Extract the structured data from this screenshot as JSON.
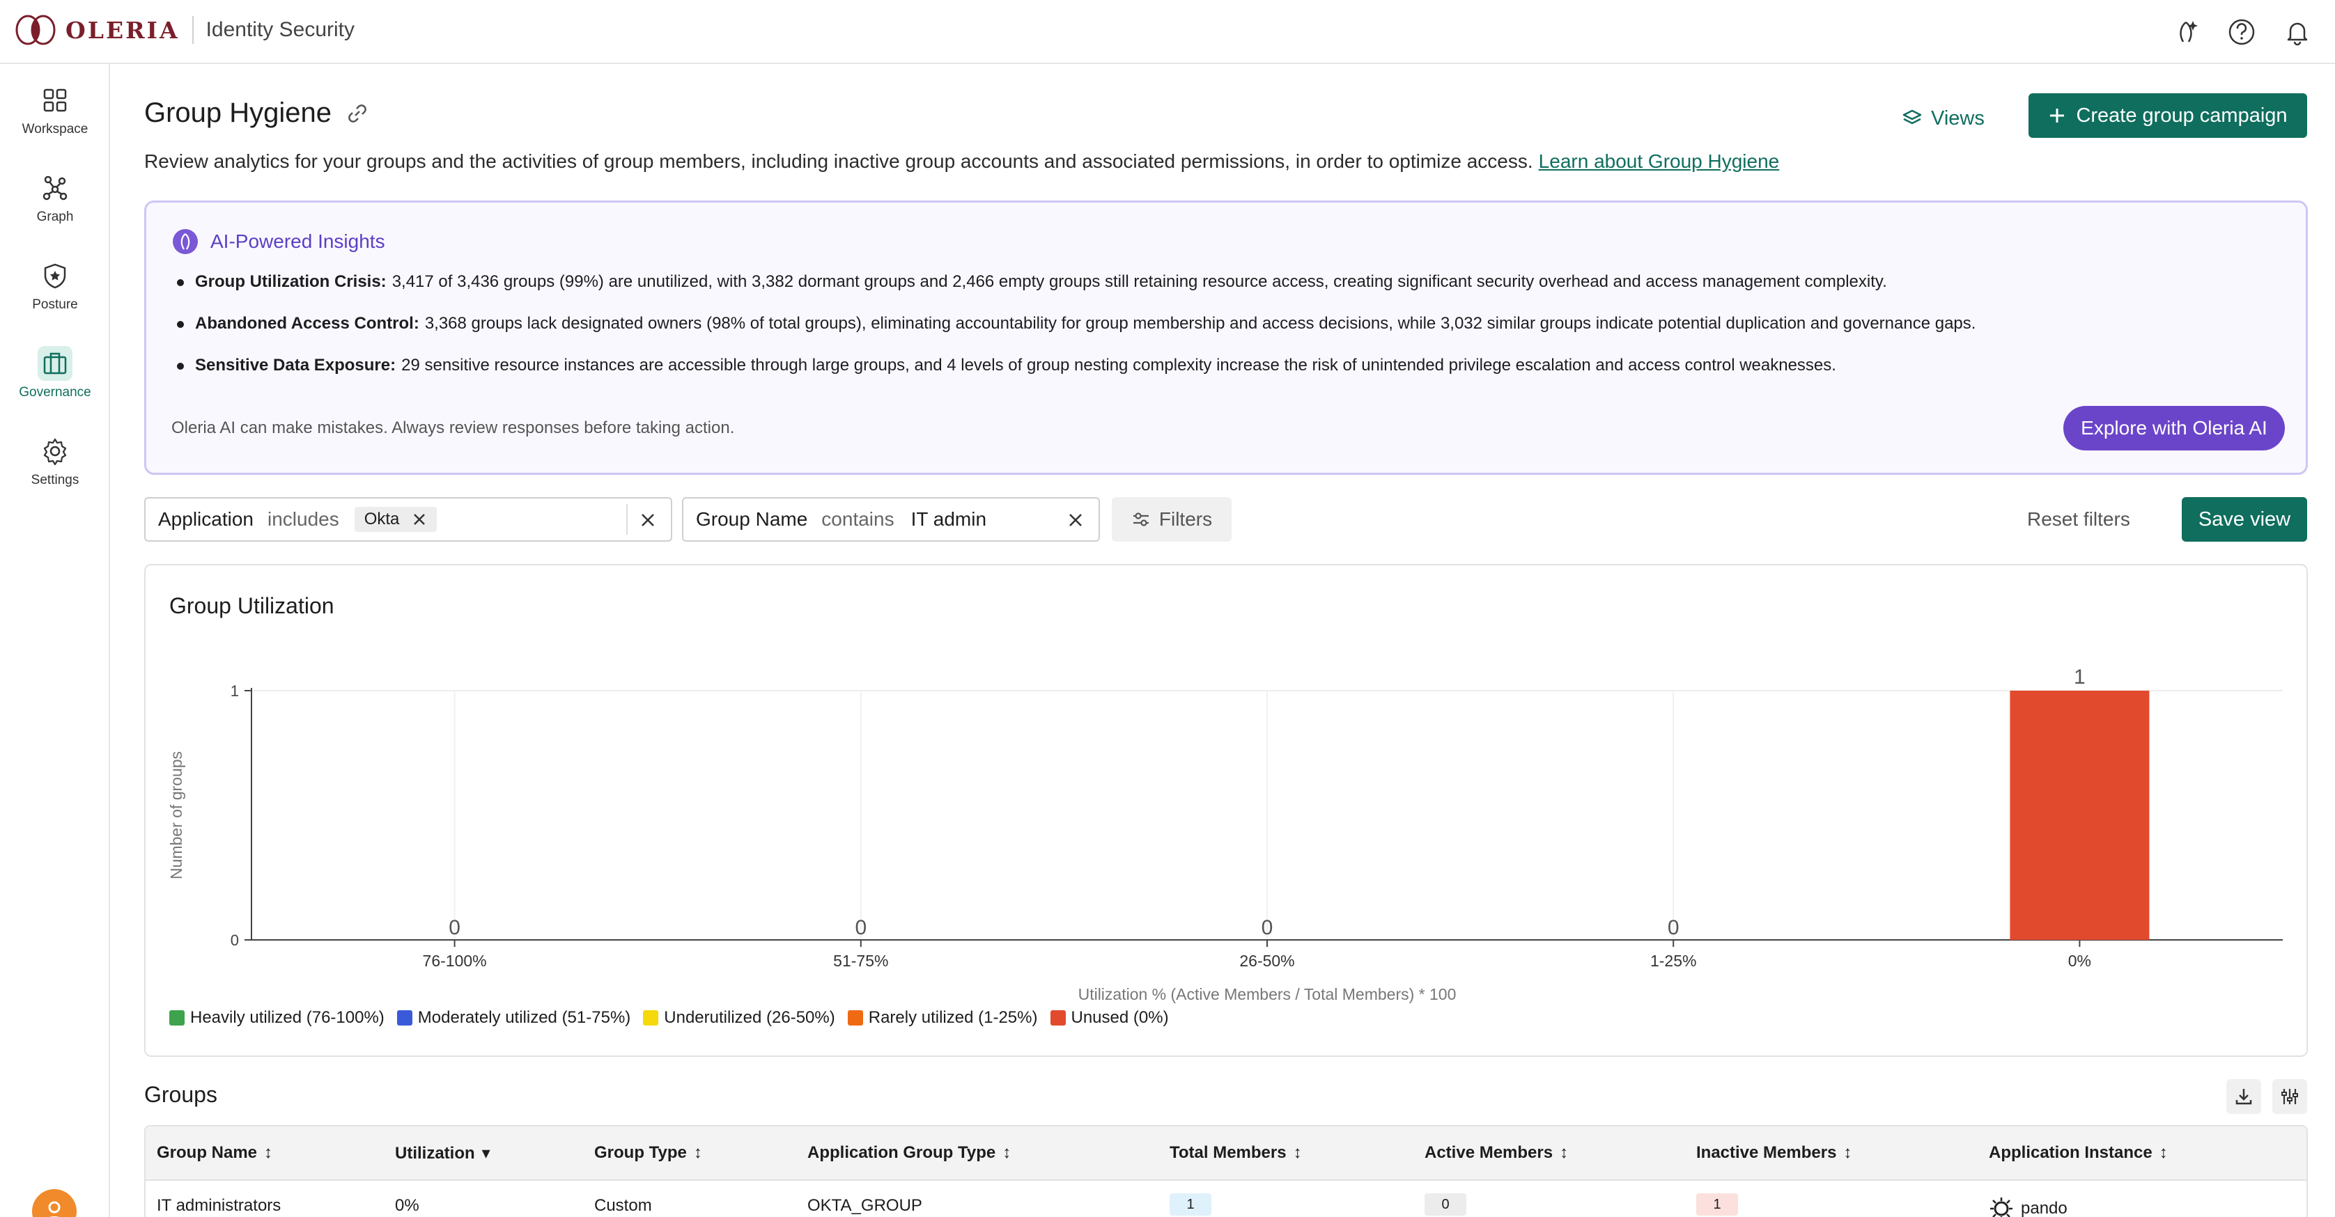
{
  "app": {
    "brand": "OLERIA",
    "product": "Identity Security"
  },
  "sidebar": {
    "items": [
      {
        "label": "Workspace",
        "icon": "grid-icon"
      },
      {
        "label": "Graph",
        "icon": "graph-icon"
      },
      {
        "label": "Posture",
        "icon": "shield-icon"
      },
      {
        "label": "Governance",
        "icon": "briefcase-icon",
        "active": true
      },
      {
        "label": "Settings",
        "icon": "gear-icon"
      }
    ]
  },
  "page": {
    "title": "Group Hygiene",
    "description": "Review analytics for your groups and the activities of group members, including inactive group accounts and associated permissions, in order to optimize access.",
    "learn_link": "Learn about Group Hygiene",
    "views_label": "Views",
    "create_label": "Create group campaign"
  },
  "ai": {
    "header": "AI-Powered Insights",
    "insights": [
      {
        "bold": "Group Utilization Crisis:",
        "text": "3,417 of 3,436 groups (99%) are unutilized, with 3,382 dormant groups and 2,466 empty groups still retaining resource access, creating significant security overhead and access management complexity."
      },
      {
        "bold": "Abandoned Access Control:",
        "text": "3,368 groups lack designated owners (98% of total groups), eliminating accountability for group membership and access decisions, while 3,032 similar groups indicate potential duplication and governance gaps."
      },
      {
        "bold": "Sensitive Data Exposure:",
        "text": "29 sensitive resource instances are accessible through large groups, and 4 levels of group nesting complexity increase the risk of unintended privilege escalation and access control weaknesses."
      }
    ],
    "disclaimer": "Oleria AI can make mistakes. Always review responses before taking action.",
    "explore_label": "Explore with Oleria AI"
  },
  "filters": {
    "f1": {
      "field": "Application",
      "op": "includes",
      "chip": "Okta"
    },
    "f2": {
      "field": "Group Name",
      "op": "contains",
      "value": "IT admin"
    },
    "filters_label": "Filters",
    "reset_label": "Reset filters",
    "save_label": "Save view"
  },
  "chart_data": {
    "type": "bar",
    "title": "Group Utilization",
    "categories": [
      "76-100%",
      "51-75%",
      "26-50%",
      "1-25%",
      "0%"
    ],
    "values": [
      0,
      0,
      0,
      0,
      1
    ],
    "colors": [
      "#3fa34d",
      "#3a5bd9",
      "#f5d90a",
      "#f06a14",
      "#e24a2e"
    ],
    "xlabel": "Utilization % (Active Members / Total Members) * 100",
    "ylabel": "Number of groups",
    "ylim": [
      0,
      1
    ],
    "yticks": [
      "0",
      "1"
    ],
    "legend": [
      "Heavily utilized (76-100%)",
      "Moderately utilized (51-75%)",
      "Underutilized (26-50%)",
      "Rarely utilized (1-25%)",
      "Unused (0%)"
    ],
    "legend_position": "bottom-left"
  },
  "groups": {
    "title": "Groups",
    "columns": [
      "Group Name",
      "Utilization",
      "Group Type",
      "Application Group Type",
      "Total Members",
      "Active Members",
      "Inactive Members",
      "Application Instance"
    ],
    "rows": [
      {
        "name": "IT administrators",
        "utilization": "0%",
        "type": "Custom",
        "app_type": "OKTA_GROUP",
        "total": "1",
        "active": "0",
        "inactive": "1",
        "instance": "pando"
      }
    ]
  }
}
